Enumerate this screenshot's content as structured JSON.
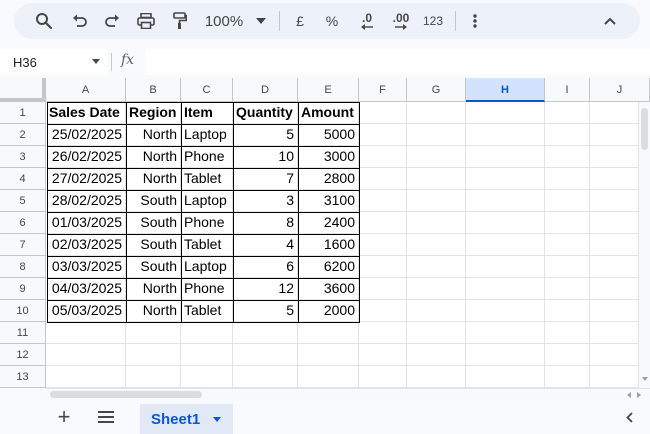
{
  "toolbar": {
    "zoom": "100%",
    "currency": "£",
    "percent": "%",
    "decrease_decimal": ".0",
    "increase_decimal": ".00",
    "number_format": "123",
    "icons": [
      "search-icon",
      "undo-icon",
      "redo-icon",
      "print-icon",
      "paint-format-icon",
      "zoom-dropdown-icon",
      "more-vert-icon",
      "collapse-chevron-icon"
    ]
  },
  "formula_bar": {
    "name_box": "H36",
    "fx": "fx",
    "formula": ""
  },
  "columns": [
    "A",
    "B",
    "C",
    "D",
    "E",
    "F",
    "G",
    "H",
    "I",
    "J"
  ],
  "selected_column": "H",
  "rows": [
    "1",
    "2",
    "3",
    "4",
    "5",
    "6",
    "7",
    "8",
    "9",
    "10",
    "11",
    "12",
    "13"
  ],
  "table": {
    "headers": [
      "Sales Date",
      "Region",
      "Item",
      "Quantity",
      "Amount"
    ],
    "data": [
      [
        "25/02/2025",
        "North",
        "Laptop",
        "5",
        "5000"
      ],
      [
        "26/02/2025",
        "North",
        "Phone",
        "10",
        "3000"
      ],
      [
        "27/02/2025",
        "North",
        "Tablet",
        "7",
        "2800"
      ],
      [
        "28/02/2025",
        "South",
        "Laptop",
        "3",
        "3100"
      ],
      [
        "01/03/2025",
        "South",
        "Phone",
        "8",
        "2400"
      ],
      [
        "02/03/2025",
        "South",
        "Tablet",
        "4",
        "1600"
      ],
      [
        "03/03/2025",
        "South",
        "Laptop",
        "6",
        "6200"
      ],
      [
        "04/03/2025",
        "North",
        "Phone",
        "12",
        "3600"
      ],
      [
        "05/03/2025",
        "North",
        "Tablet",
        "5",
        "2000"
      ]
    ]
  },
  "sheets": {
    "add_label": "+",
    "active": "Sheet1"
  },
  "colors": {
    "accent": "#0b57d0",
    "toolbar_bg": "#edf2fa",
    "selected_header_bg": "#d3e3fd"
  }
}
